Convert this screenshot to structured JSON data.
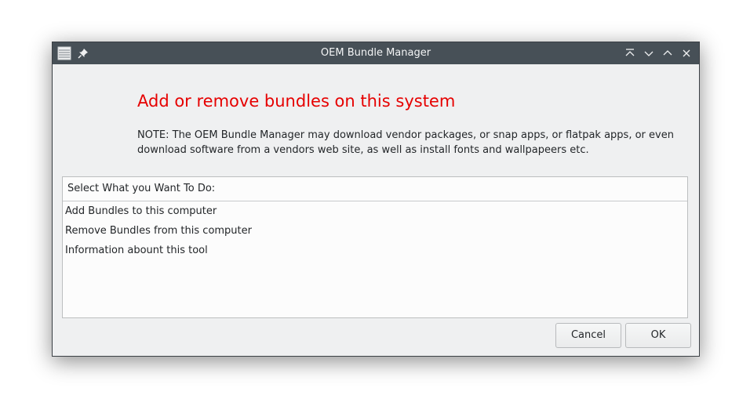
{
  "window": {
    "title": "OEM Bundle Manager",
    "menu_icon": "list-menu-icon",
    "pin_icon": "pin-icon",
    "controls": [
      "keep-above-icon",
      "minimize-icon",
      "maximize-icon",
      "close-icon"
    ]
  },
  "main": {
    "heading": "Add or remove bundles on this system",
    "note": "NOTE: The OEM Bundle Manager may download vendor packages, or snap apps, or flatpak apps, or even download software from a vendors web site, as well as install fonts and wallpapeers etc."
  },
  "list": {
    "header": "Select What you Want To Do:",
    "items": [
      "Add Bundles to this computer",
      "Remove Bundles from this computer",
      "Information abount this tool"
    ]
  },
  "buttons": {
    "cancel": "Cancel",
    "ok": "OK"
  },
  "colors": {
    "titlebar": "#475057",
    "heading": "#e60000",
    "window_bg": "#eff0f1"
  }
}
